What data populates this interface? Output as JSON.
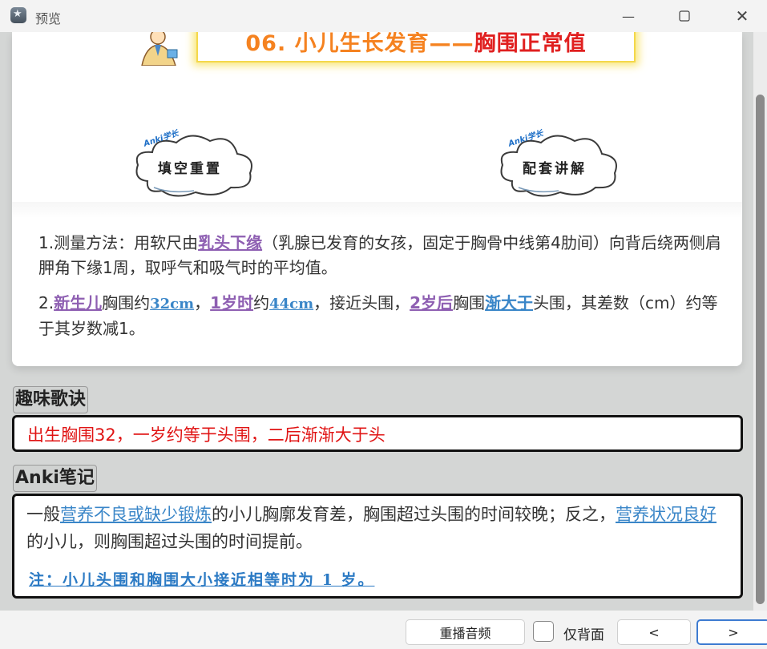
{
  "window": {
    "title": "预览"
  },
  "banner": {
    "number": "06. 小儿生长发育——",
    "subject": "胸围正常值"
  },
  "clouds": [
    {
      "tag": "Anki学长",
      "label": "填空重置"
    },
    {
      "tag": "Anki学长",
      "label": "配套讲解"
    }
  ],
  "p1": {
    "prefix": "1.测量方法：用软尺由",
    "hl1": "乳头下缘",
    "rest": "（乳腺已发育的女孩，固定于胸骨中线第4肋间）向背后绕两侧肩胛角下缘1周，取呼气和吸气时的平均值。"
  },
  "p2": {
    "num": "2.",
    "hl1": "新生儿",
    "t1": "胸围约",
    "v1": "32cm",
    "t2": "，",
    "hl2": "1岁时",
    "t3": "约",
    "v2": "44cm",
    "t4": "，接近头围，",
    "hl3": "2岁后",
    "t5": "胸围",
    "v3": "渐大于",
    "t6": "头围，其差数（cm）约等于其岁数减1。"
  },
  "section1": {
    "label": "趣味歌诀",
    "text": "出生胸围32，一岁约等于头围，二后渐渐大于头"
  },
  "section2": {
    "label": "Anki笔记",
    "t1": "一般",
    "u1": "营养不良或缺少锻炼",
    "t2": "的小儿胸廓发育差，胸围超过头围的时间较晚；反之，",
    "u2": "营养状况良好",
    "t3": "的小儿，则胸围超过头围的时间提前。",
    "note": "注：小儿头围和胸围大小接近相等时为 1 岁。"
  },
  "bottom": {
    "replay": "重播音频",
    "back_only": "仅背面",
    "prev": "<",
    "next": ">"
  }
}
